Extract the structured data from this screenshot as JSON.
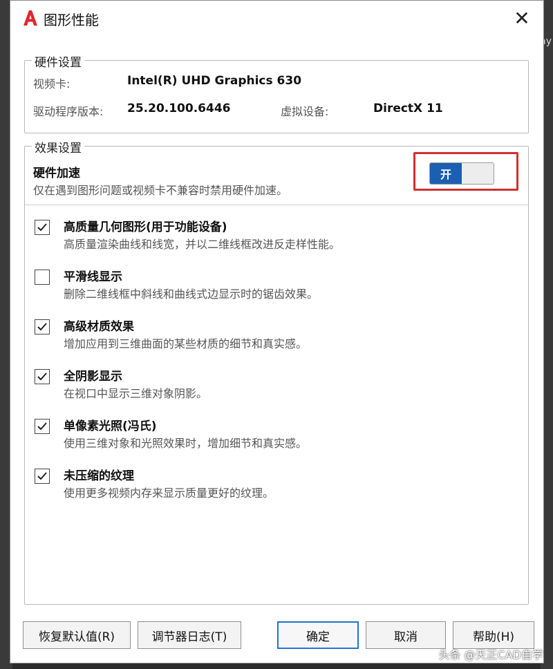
{
  "window": {
    "title": "图形性能",
    "close_symbol": "✕"
  },
  "hardware": {
    "legend": "硬件设置",
    "video_card_label": "视频卡:",
    "video_card_value": "Intel(R) UHD Graphics 630",
    "driver_label": "驱动程序版本:",
    "driver_value": "25.20.100.6446",
    "virtual_device_label": "虚拟设备:",
    "virtual_device_value": "DirectX 11"
  },
  "effects": {
    "legend": "效果设置",
    "hw_accel_title": "硬件加速",
    "hw_accel_desc": "仅在遇到图形问题或视频卡不兼容时禁用硬件加速。",
    "toggle_label": "开",
    "toggle_state": "on",
    "options": [
      {
        "title": "高质量几何图形(用于功能设备)",
        "desc": "高质量渲染曲线和线宽，并以二维线框改进反走样性能。",
        "checked": true
      },
      {
        "title": "平滑线显示",
        "desc": "删除二维线框中斜线和曲线式边显示时的锯齿效果。",
        "checked": false
      },
      {
        "title": "高级材质效果",
        "desc": "增加应用到三维曲面的某些材质的细节和真实感。",
        "checked": true
      },
      {
        "title": "全阴影显示",
        "desc": "在视口中显示三维对象阴影。",
        "checked": true
      },
      {
        "title": "单像素光照(冯氏)",
        "desc": "使用三维对象和光照效果时，增加细节和真实感。",
        "checked": true
      },
      {
        "title": "未压缩的纹理",
        "desc": "使用更多视频内存来显示质量更好的纹理。",
        "checked": true
      }
    ]
  },
  "buttons": {
    "restore_defaults": "恢复默认值(R)",
    "tuner_log": "调节器日志(T)",
    "ok": "确定",
    "cancel": "取消",
    "help": "帮助(H)"
  },
  "background": {
    "right_edge_text": "ay"
  },
  "watermark": "头条 @天正CAD自学",
  "colors": {
    "accent_blue": "#1b5fb2",
    "highlight_red": "#d32f2f",
    "app_icon_red": "#e0262f"
  },
  "icons": {
    "app": "autocad-a-icon",
    "close": "close-icon",
    "check": "checkmark-icon"
  }
}
